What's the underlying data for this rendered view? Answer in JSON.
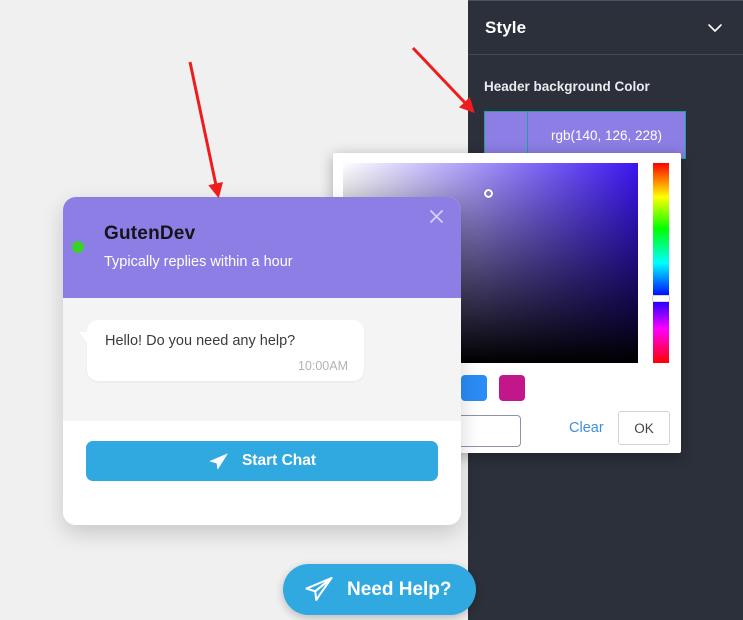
{
  "sidebar": {
    "panel_title": "Style",
    "collapse_icon": "chevron-down-icon",
    "field_label": "Header background Color",
    "color_button": {
      "value_text": "rgb(140, 126, 228)",
      "swatch_color": "#8c7ee4",
      "border_color": "#20a0a0"
    },
    "background_color": "#2b303a"
  },
  "color_picker": {
    "saturation_cursor_label": "saturation-cursor",
    "hue_handle_label": "hue-handle",
    "preset_swatches": [
      {
        "name": "yellow",
        "color": "#f5d20c"
      },
      {
        "name": "green",
        "color": "#7ee68a"
      },
      {
        "name": "teal",
        "color": "#0cd3cb"
      },
      {
        "name": "blue",
        "color": "#2b8cf5"
      },
      {
        "name": "magenta",
        "color": "#c4168b"
      }
    ],
    "hex_input_value": "",
    "hex_input_placeholder": "",
    "clear_label": "Clear",
    "ok_label": "OK"
  },
  "chat_widget": {
    "title": "GutenDev",
    "subtitle": "Typically replies within a hour",
    "close_icon": "close-icon",
    "status_icon": "online-status-dot",
    "header_color": "#8c7ee4",
    "message": {
      "text": "Hello! Do you need any help?",
      "time": "10:00AM"
    },
    "start_chat_label": "Start Chat",
    "start_chat_icon": "paper-plane-icon",
    "accent_color": "#30a8e0"
  },
  "launcher": {
    "label": "Need Help?",
    "icon": "paper-plane-outline-icon",
    "color": "#30a8e0"
  },
  "annotations": {
    "arrow_color": "#ee1c1c",
    "arrow_1": "points-to-chat-widget-header",
    "arrow_2": "points-to-header-background-color-field"
  }
}
